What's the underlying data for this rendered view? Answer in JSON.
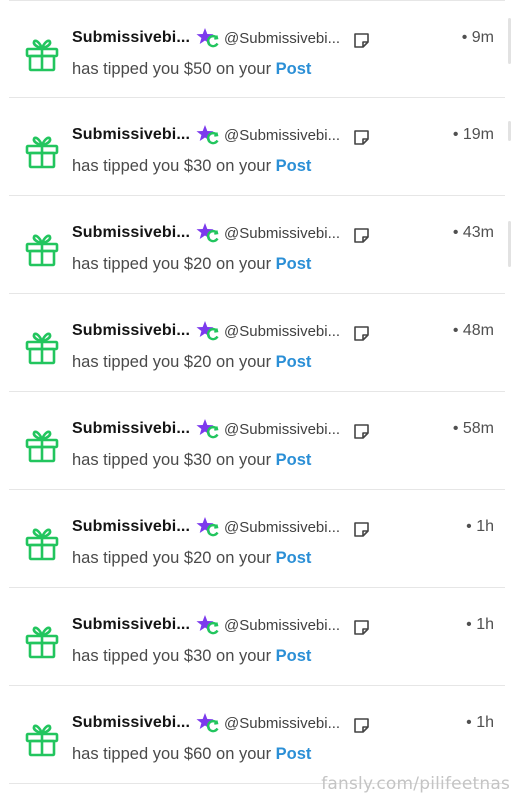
{
  "notifications": [
    {
      "name": "Submissivebi...",
      "handle": "@Submissivebi...",
      "time": "• 9m",
      "prefix": "has tipped you ",
      "amount": "$50",
      "middle": " on your ",
      "link": "Post"
    },
    {
      "name": "Submissivebi...",
      "handle": "@Submissivebi...",
      "time": "• 19m",
      "prefix": "has tipped you ",
      "amount": "$30",
      "middle": " on your ",
      "link": "Post"
    },
    {
      "name": "Submissivebi...",
      "handle": "@Submissivebi...",
      "time": "• 43m",
      "prefix": "has tipped you ",
      "amount": "$20",
      "middle": " on your ",
      "link": "Post"
    },
    {
      "name": "Submissivebi...",
      "handle": "@Submissivebi...",
      "time": "• 48m",
      "prefix": "has tipped you ",
      "amount": "$20",
      "middle": " on your ",
      "link": "Post"
    },
    {
      "name": "Submissivebi...",
      "handle": "@Submissivebi...",
      "time": "• 58m",
      "prefix": "has tipped you ",
      "amount": "$30",
      "middle": " on your ",
      "link": "Post"
    },
    {
      "name": "Submissivebi...",
      "handle": "@Submissivebi...",
      "time": "• 1h",
      "prefix": "has tipped you ",
      "amount": "$20",
      "middle": " on your ",
      "link": "Post"
    },
    {
      "name": "Submissivebi...",
      "handle": "@Submissivebi...",
      "time": "• 1h",
      "prefix": "has tipped you ",
      "amount": "$30",
      "middle": " on your ",
      "link": "Post"
    },
    {
      "name": "Submissivebi...",
      "handle": "@Submissivebi...",
      "time": "• 1h",
      "prefix": "has tipped you ",
      "amount": "$60",
      "middle": " on your ",
      "link": "Post"
    }
  ],
  "icons": {
    "gift": "gift-icon",
    "badge": "verified-star-icon",
    "note": "note-icon"
  },
  "colors": {
    "gift": "#22c55e",
    "link": "#2b8fd6",
    "star": "#7c3aed",
    "star_check": "#22c55e"
  },
  "watermark": "fansly.com/pilifeetnas"
}
